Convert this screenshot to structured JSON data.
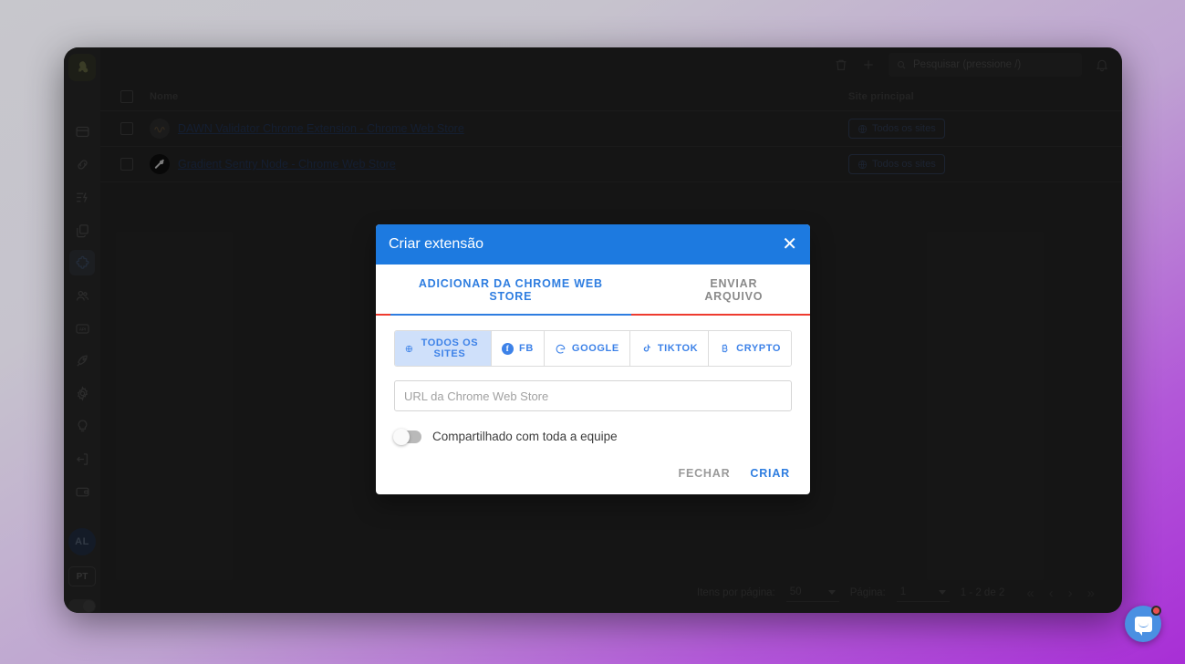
{
  "background": {
    "gradient_from": "#c7c7cc",
    "gradient_to": "#a82ed6"
  },
  "app": {
    "logo_name": "app-logo",
    "topbar": {
      "trash_icon": "trash-icon",
      "add_icon": "plus-icon",
      "search_placeholder": "Pesquisar (pressione /)",
      "search_value": "",
      "bell_icon": "bell-icon"
    },
    "sidebar": {
      "items": [
        {
          "name": "browser-profiles",
          "icon": "window-icon",
          "active": false
        },
        {
          "name": "proxies",
          "icon": "link-icon",
          "active": false
        },
        {
          "name": "automation",
          "icon": "flash-list-icon",
          "active": false
        },
        {
          "name": "templates",
          "icon": "copy-icon",
          "active": false
        },
        {
          "name": "extensions",
          "icon": "puzzle-icon",
          "active": true
        },
        {
          "name": "team",
          "icon": "users-icon",
          "active": false
        },
        {
          "name": "api",
          "icon": "api-icon",
          "active": false
        },
        {
          "name": "quick-start",
          "icon": "rocket-icon",
          "active": false
        },
        {
          "name": "settings",
          "icon": "gear-icon",
          "active": false
        },
        {
          "name": "tips",
          "icon": "lightbulb-icon",
          "active": false
        },
        {
          "name": "logout",
          "icon": "logout-icon",
          "active": false
        },
        {
          "name": "billing",
          "icon": "wallet-icon",
          "active": false
        }
      ],
      "avatar_initials": "AL",
      "language": "PT"
    },
    "table": {
      "headers": {
        "name": "Nome",
        "site": "Site principal"
      },
      "rows": [
        {
          "icon": "dawn-validator-icon",
          "name": "DAWN Validator Chrome Extension - Chrome Web Store",
          "site_chip": "Todos os sites"
        },
        {
          "icon": "gradient-sentry-icon",
          "name": "Gradient Sentry Node - Chrome Web Store",
          "site_chip": "Todos os sites"
        }
      ]
    },
    "pagination": {
      "items_per_page_label": "Itens por página:",
      "items_per_page_value": "50",
      "page_label": "Página:",
      "page_value": "1",
      "range": "1 - 2 de 2",
      "first_icon": "«",
      "prev_icon": "‹",
      "next_icon": "›",
      "last_icon": "»"
    },
    "intercom": {
      "name": "intercom-launcher",
      "badge_color": "#e8504f",
      "bubble_color": "#4a90e2"
    }
  },
  "modal": {
    "title": "Criar extensão",
    "close_icon": "✕",
    "header_color": "#1d7ae0",
    "accent_color": "#2e7de0",
    "underline_color": "#ee3b2f",
    "tabs": [
      {
        "label": "ADICIONAR DA CHROME WEB STORE",
        "active": true
      },
      {
        "label": "ENVIAR ARQUIVO",
        "active": false
      }
    ],
    "filters": [
      {
        "label": "TODOS OS SITES",
        "icon": "globe-icon",
        "active": true
      },
      {
        "label": "FB",
        "icon": "facebook-icon",
        "active": false
      },
      {
        "label": "GOOGLE",
        "icon": "google-icon",
        "active": false
      },
      {
        "label": "TIKTOK",
        "icon": "tiktok-icon",
        "active": false
      },
      {
        "label": "CRYPTO",
        "icon": "bitcoin-icon",
        "active": false
      }
    ],
    "url_placeholder": "URL da Chrome Web Store",
    "url_value": "",
    "share_label": "Compartilhado com toda a equipe",
    "share_enabled": false,
    "close_button": "FECHAR",
    "create_button": "CRIAR"
  }
}
